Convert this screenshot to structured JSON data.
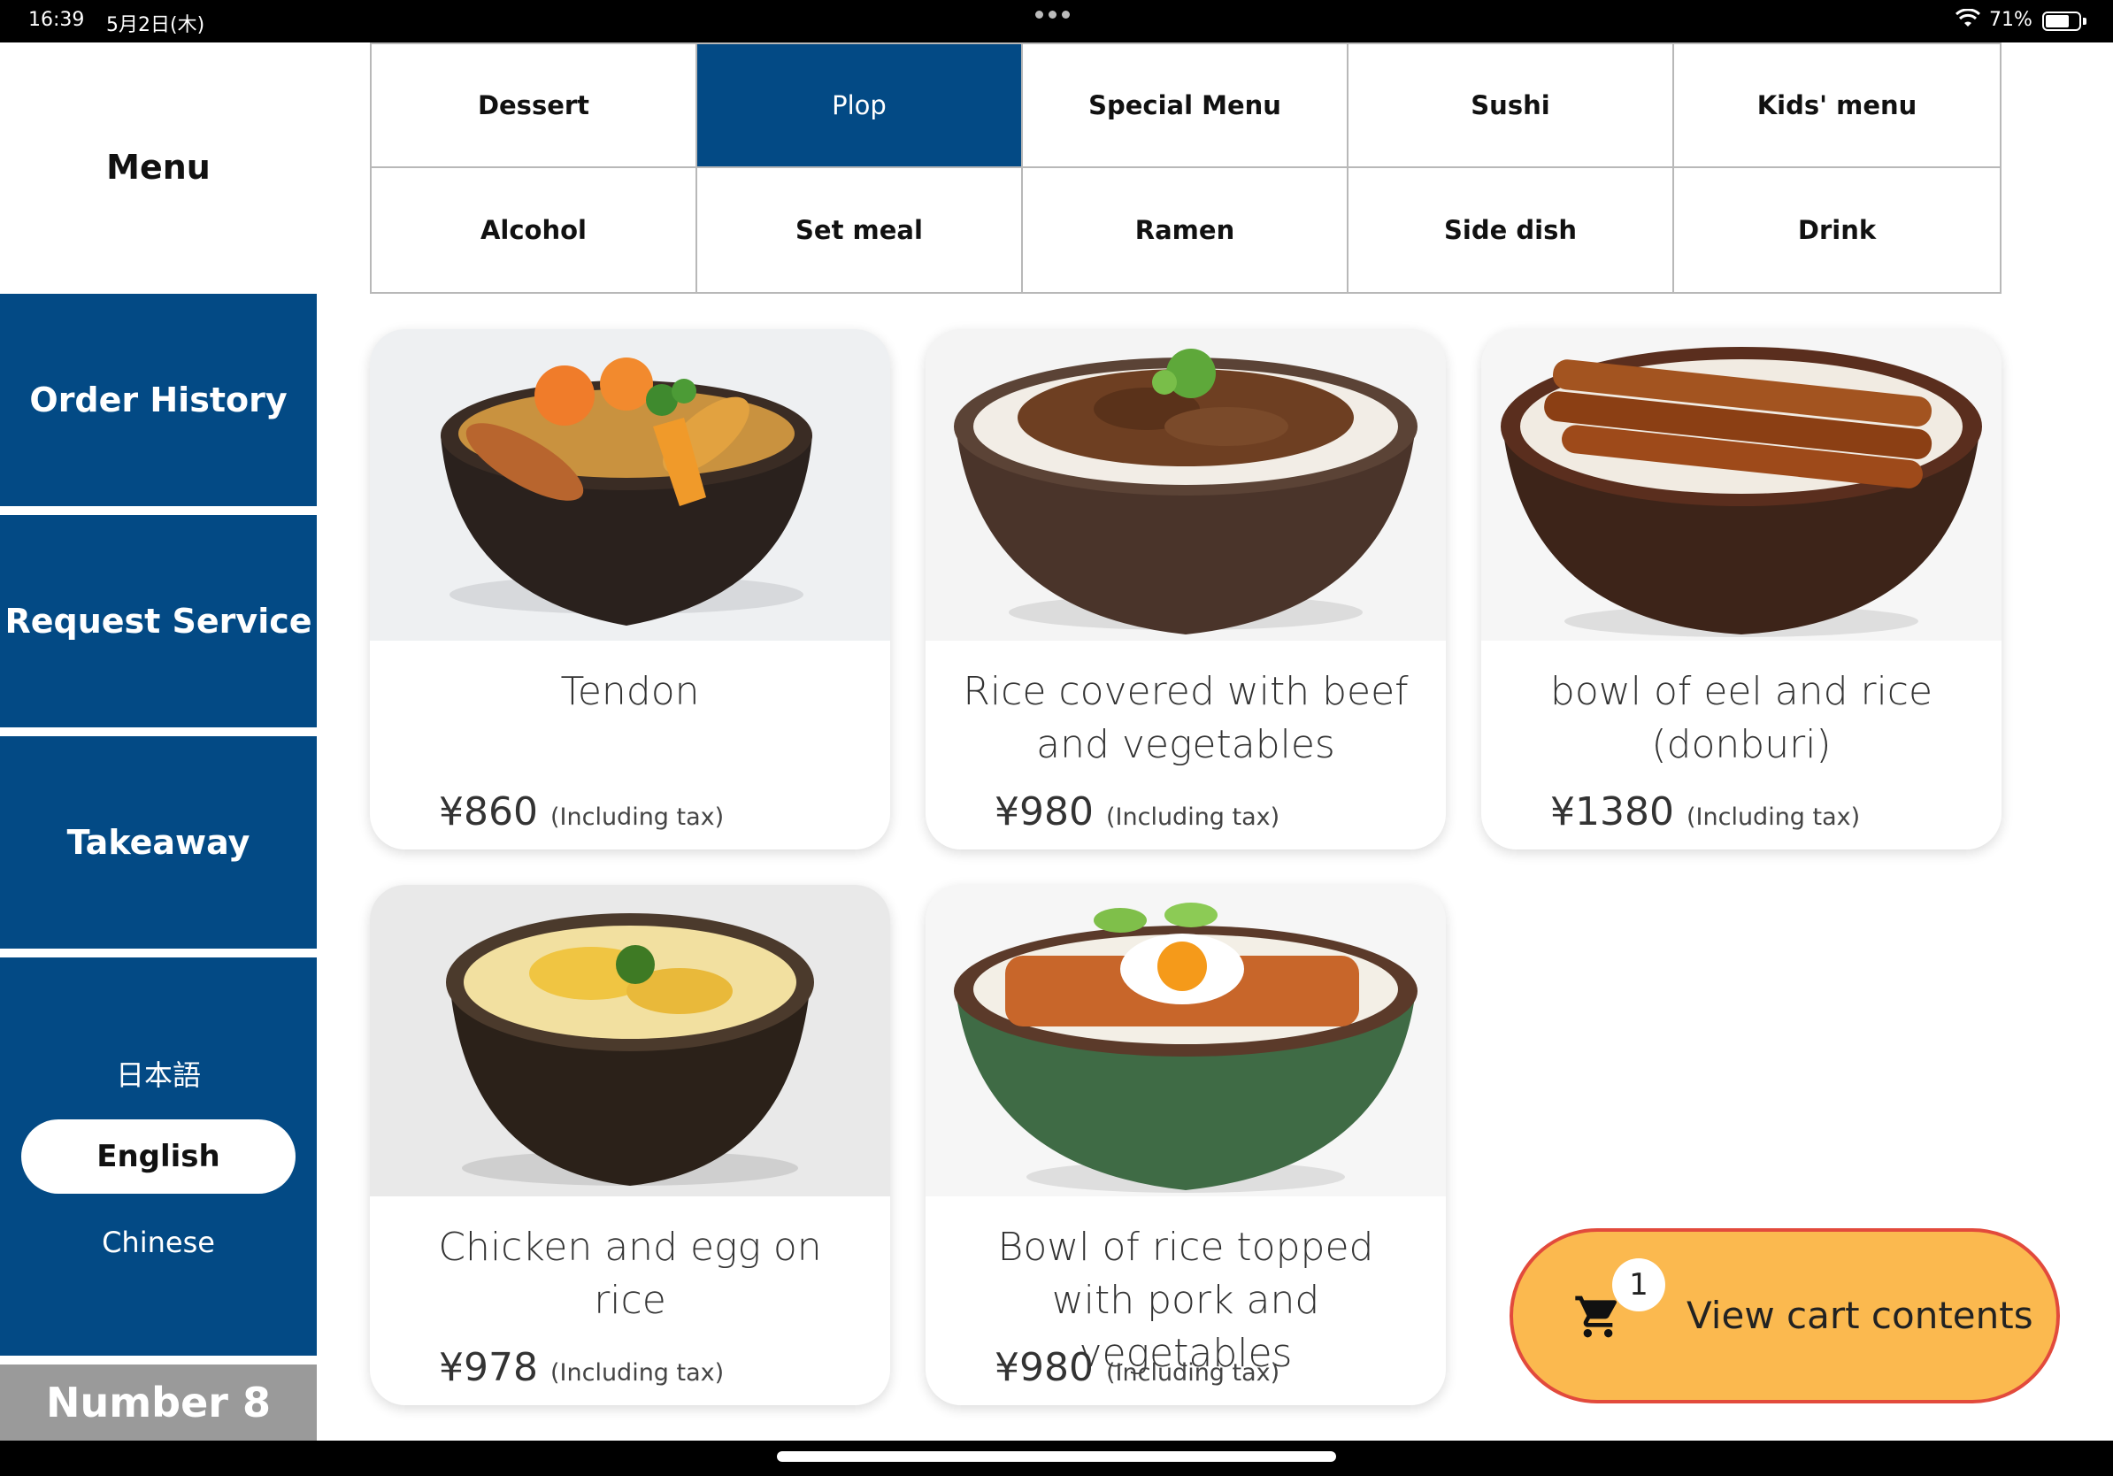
{
  "status_bar": {
    "time": "16:39",
    "date": "5月2日(木)",
    "battery": "71%",
    "battery_level": 0.71
  },
  "sidebar": {
    "title": "Menu",
    "order_history": "Order History",
    "request_service": "Request Service",
    "takeaway": "Takeaway",
    "languages": {
      "japanese": "日本語",
      "english": "English",
      "chinese": "Chinese",
      "selected": "English"
    },
    "table_number": "Number 8"
  },
  "categories": {
    "tabs": [
      "Dessert",
      "Plop",
      "Special Menu",
      "Sushi",
      "Kids' menu",
      "Alcohol",
      "Set meal",
      "Ramen",
      "Side dish",
      "Drink"
    ],
    "active": "Plop"
  },
  "items": [
    {
      "name": "Tendon",
      "price": "¥860",
      "tax": "(Including tax)"
    },
    {
      "name": "Rice covered with beef and vegetables",
      "price": "¥980",
      "tax": "(Including tax)"
    },
    {
      "name": "bowl of eel and rice (donburi)",
      "price": "¥1380",
      "tax": "(Including tax)"
    },
    {
      "name": "Chicken and egg on rice",
      "price": "¥978",
      "tax": "(Including tax)"
    },
    {
      "name": "Bowl of rice topped with pork and vegetables",
      "price": "¥980",
      "tax": "(Including tax)"
    }
  ],
  "cart": {
    "count": "1",
    "label": "View cart contents"
  },
  "colors": {
    "primary": "#034a85",
    "cart_bg": "#fbb94f",
    "cart_border": "#e24a3c"
  }
}
